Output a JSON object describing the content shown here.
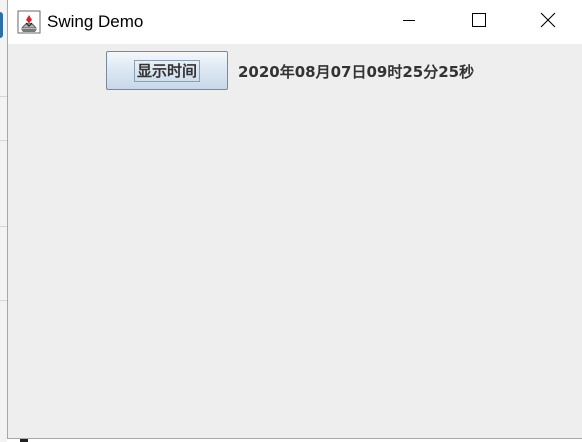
{
  "window": {
    "title": "Swing Demo",
    "icon": "java-coffee-cup-icon"
  },
  "title_controls": {
    "minimize_icon": "minimize-icon",
    "maximize_icon": "maximize-icon",
    "close_icon": "close-icon"
  },
  "content": {
    "show_time_button_label": "显示时间",
    "time_label": "2020年08月07日09时25分25秒"
  },
  "colors": {
    "titlebar_bg": "#ffffff",
    "content_bg": "#eeeeee",
    "label_text": "#333333"
  }
}
